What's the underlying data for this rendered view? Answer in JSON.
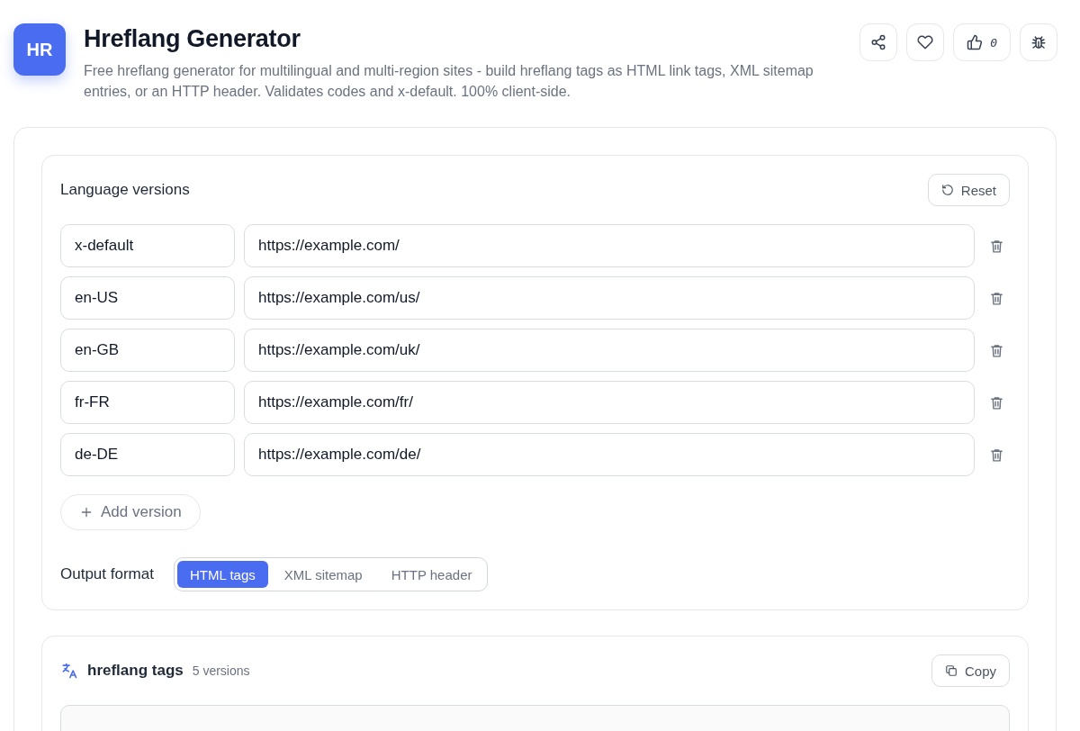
{
  "app": {
    "logo": "HR",
    "title": "Hreflang Generator",
    "description": "Free hreflang generator for multilingual and multi-region sites - build hreflang tags as HTML link tags, XML sitemap entries, or an HTTP header. Validates codes and x-default. 100% client-side.",
    "likes": "0"
  },
  "versions": {
    "title": "Language versions",
    "reset": "Reset",
    "rows": [
      {
        "code": "x-default",
        "url": "https://example.com/"
      },
      {
        "code": "en-US",
        "url": "https://example.com/us/"
      },
      {
        "code": "en-GB",
        "url": "https://example.com/uk/"
      },
      {
        "code": "fr-FR",
        "url": "https://example.com/fr/"
      },
      {
        "code": "de-DE",
        "url": "https://example.com/de/"
      }
    ],
    "add": "Add version",
    "format_label": "Output format",
    "formats": [
      {
        "label": "HTML tags",
        "selected": true
      },
      {
        "label": "XML sitemap",
        "selected": false
      },
      {
        "label": "HTTP header",
        "selected": false
      }
    ]
  },
  "output": {
    "title": "hreflang tags",
    "count": "5 versions",
    "copy": "Copy"
  }
}
